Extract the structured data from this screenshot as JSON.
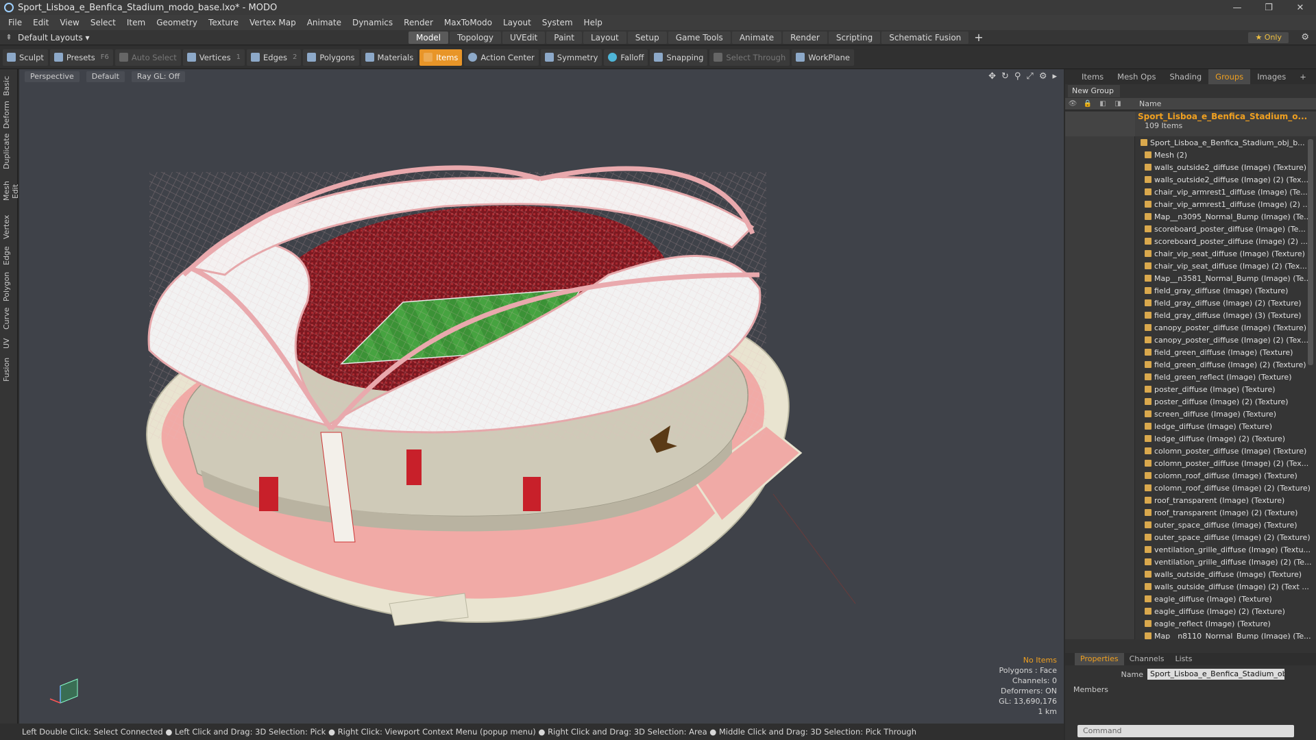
{
  "window": {
    "title": "Sport_Lisboa_e_Benfica_Stadium_modo_base.lxo* - MODO",
    "min": "—",
    "max": "❐",
    "close": "✕"
  },
  "menu": [
    "File",
    "Edit",
    "View",
    "Select",
    "Item",
    "Geometry",
    "Texture",
    "Vertex Map",
    "Animate",
    "Dynamics",
    "Render",
    "MaxToModo",
    "Layout",
    "System",
    "Help"
  ],
  "layout": {
    "default": "Default Layouts ▾",
    "tabs": [
      "Model",
      "Topology",
      "UVEdit",
      "Paint",
      "Layout",
      "Setup",
      "Game Tools",
      "Animate",
      "Render",
      "Scripting",
      "Schematic Fusion"
    ],
    "active_tab": "Model",
    "only": "★ Only"
  },
  "toolbar": {
    "sculpt": "Sculpt",
    "presets": "Presets",
    "presets_key": "F6",
    "auto_select": "Auto Select",
    "vertices": "Vertices",
    "vertices_n": "1",
    "edges": "Edges",
    "edges_n": "2",
    "polygons": "Polygons",
    "materials": "Materials",
    "items": "Items",
    "action_center": "Action Center",
    "symmetry": "Symmetry",
    "falloff": "Falloff",
    "snapping": "Snapping",
    "select_through": "Select Through",
    "workplane": "WorkPlane"
  },
  "left_tabs": [
    "Basic",
    "Deform",
    "Duplicate",
    "Mesh Edit",
    "Vertex",
    "Edge",
    "Polygon",
    "Curve",
    "UV",
    "Fusion"
  ],
  "viewport": {
    "perspective": "Perspective",
    "shading": "Default",
    "raygl": "Ray GL: Off",
    "info": {
      "selection": "No Items",
      "polygons": "Polygons : Face",
      "channels": "Channels: 0",
      "deformers": "Deformers: ON",
      "gl": "GL: 13,690,176",
      "scale": "1 km"
    }
  },
  "status": "Left Double Click: Select Connected ● Left Click and Drag: 3D Selection: Pick ● Right Click: Viewport Context Menu (popup menu) ● Right Click and Drag: 3D Selection: Area ● Middle Click and Drag: 3D Selection: Pick Through",
  "right_panel": {
    "tabs": [
      "Items",
      "Mesh Ops",
      "Shading",
      "Groups",
      "Images"
    ],
    "active_tab": "Groups",
    "plus": "+",
    "new_group": "New Group",
    "col_name": "Name",
    "group": {
      "name": "Sport_Lisboa_e_Benfica_Stadium_o...",
      "count": "109 Items"
    },
    "items": [
      "Sport_Lisboa_e_Benfica_Stadium_obj_b...",
      "Mesh (2)",
      "walls_outside2_diffuse (Image) (Texture)",
      "walls_outside2_diffuse (Image) (2) (Tex...",
      "chair_vip_armrest1_diffuse (Image) (Te...",
      "chair_vip_armrest1_diffuse (Image) (2) ...",
      "Map__n3095_Normal_Bump (Image) (Te...",
      "scoreboard_poster_diffuse (Image) (Te...",
      "scoreboard_poster_diffuse (Image) (2) ...",
      "chair_vip_seat_diffuse (Image) (Texture)",
      "chair_vip_seat_diffuse (Image) (2) (Tex...",
      "Map__n3581_Normal_Bump (Image) (Te...",
      "field_gray_diffuse (Image) (Texture)",
      "field_gray_diffuse (Image) (2) (Texture)",
      "field_gray_diffuse (Image) (3) (Texture)",
      "canopy_poster_diffuse (Image) (Texture)",
      "canopy_poster_diffuse (Image) (2) (Tex...",
      "field_green_diffuse (Image) (Texture)",
      "field_green_diffuse (Image) (2) (Texture)",
      "field_green_reflect (Image) (Texture)",
      "poster_diffuse (Image) (Texture)",
      "poster_diffuse (Image) (2) (Texture)",
      "screen_diffuse (Image) (Texture)",
      "ledge_diffuse (Image) (Texture)",
      "ledge_diffuse (Image) (2) (Texture)",
      "colomn_poster_diffuse (Image) (Texture)",
      "colomn_poster_diffuse (Image) (2) (Tex...",
      "colomn_roof_diffuse (Image) (Texture)",
      "colomn_roof_diffuse (Image) (2) (Texture)",
      "roof_transparent (Image) (Texture)",
      "roof_transparent (Image) (2) (Texture)",
      "outer_space_diffuse (Image) (Texture)",
      "outer_space_diffuse (Image) (2) (Texture)",
      "ventilation_grille_diffuse (Image) (Textu...",
      "ventilation_grille_diffuse (Image) (2) (Te...",
      "walls_outside_diffuse (Image) (Texture)",
      "walls_outside_diffuse (Image) (2) (Text ...",
      "eagle_diffuse (Image) (Texture)",
      "eagle_diffuse (Image) (2) (Texture)",
      "eagle_reflect (Image) (Texture)",
      "Map__n8110_Normal_Bump (Image) (Te..."
    ],
    "props_tabs": [
      "Properties",
      "Channels",
      "Lists"
    ],
    "props_active": "Properties",
    "name_label": "Name",
    "name_value": "Sport_Lisboa_e_Benfica_Stadium_obj_ba",
    "members": "Members",
    "command_placeholder": "Command"
  },
  "colors": {
    "accent": "#f0a020",
    "viewport_bg": "#3f4249",
    "roof": "#f2f2f2",
    "frame": "#e9a9ad",
    "seats": "#8a1c22",
    "field": "#3f9a3a",
    "plaza": "#f0a8a4"
  }
}
